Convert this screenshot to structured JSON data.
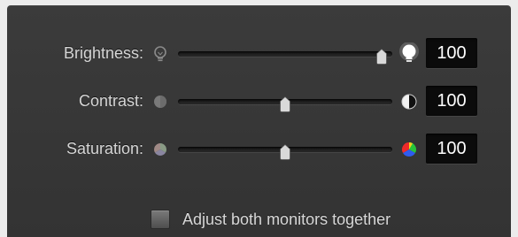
{
  "sliders": [
    {
      "label": "Brightness:",
      "value": "100",
      "position": 0.95,
      "left_icon": "bulb-dim-icon",
      "right_icon": "bulb-bright-icon"
    },
    {
      "label": "Contrast:",
      "value": "100",
      "position": 0.5,
      "left_icon": "contrast-low-icon",
      "right_icon": "contrast-high-icon"
    },
    {
      "label": "Saturation:",
      "value": "100",
      "position": 0.5,
      "left_icon": "saturation-low-icon",
      "right_icon": "saturation-high-icon"
    }
  ],
  "adjust_both": {
    "label": "Adjust both monitors together",
    "checked": false
  }
}
